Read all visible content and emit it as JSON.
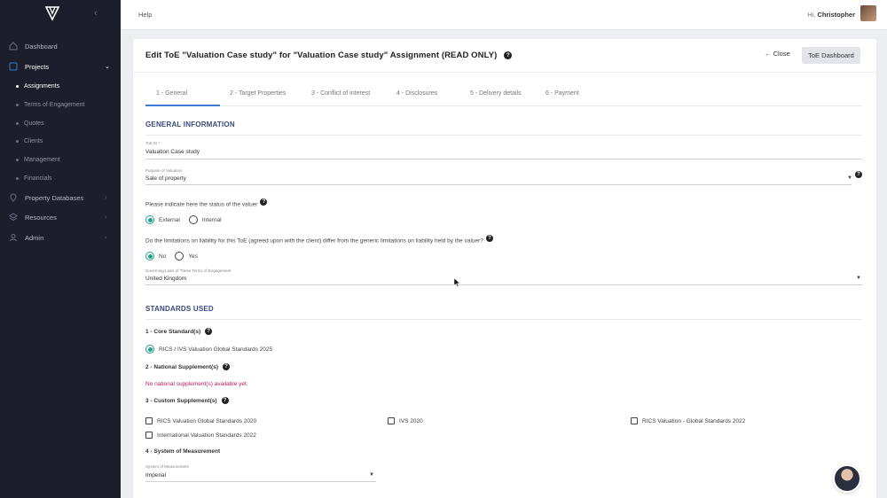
{
  "sidebar": {
    "items": [
      {
        "label": "Dashboard",
        "icon": "home-icon"
      },
      {
        "label": "Projects",
        "icon": "projects-icon"
      },
      {
        "label": "Property Databases",
        "icon": "location-icon"
      },
      {
        "label": "Resources",
        "icon": "layers-icon"
      },
      {
        "label": "Admin",
        "icon": "admin-icon"
      }
    ],
    "project_subitems": [
      {
        "label": "Assignments"
      },
      {
        "label": "Terms of Engagement"
      },
      {
        "label": "Quotes"
      },
      {
        "label": "Clients"
      },
      {
        "label": "Management"
      },
      {
        "label": "Financials"
      }
    ]
  },
  "topbar": {
    "help": "Help",
    "greeting": "Hi,",
    "user": "Christopher"
  },
  "page": {
    "title": "Edit ToE \"Valuation Case study\" for \"Valuation Case study\" Assignment (READ ONLY)",
    "help_icon": "?",
    "close_label": "Close",
    "close_arrow": "←",
    "dashboard_label": "ToE Dashboard"
  },
  "tabs": [
    {
      "label": "1 - General",
      "active": true
    },
    {
      "label": "2 - Target Properties"
    },
    {
      "label": "3 - Conflict of interest"
    },
    {
      "label": "4 - Disclosures"
    },
    {
      "label": "5 - Delivery details"
    },
    {
      "label": "6 - Payment"
    }
  ],
  "general": {
    "section_title": "GENERAL INFORMATION",
    "toe_id_label": "ToE ID *",
    "toe_id_value": "Valuation Case study",
    "purpose_label": "Purpose of Valuation",
    "purpose_value": "Sale of property",
    "valuer_status_question": "Please indicate here the status of the valuer",
    "valuer_options": [
      "External",
      "Internal"
    ],
    "valuer_selected": "External",
    "liability_question": "Do the limitations on liability for this ToE (agreed upon with the client) differ from the generic limitations on liability held by the valuer?",
    "liability_options": [
      "No",
      "Yes"
    ],
    "liability_selected": "No",
    "governing_label": "Governing Laws of These Terms of Engagement",
    "governing_value": "United Kingdom"
  },
  "standards": {
    "section_title": "STANDARDS USED",
    "core_heading": "1 - Core Standard(s)",
    "core_option": "RICS / IVS Valuation Global Standards 2025",
    "national_heading": "2 - National Supplement(s)",
    "national_warning": "No national supplement(s) available yet.",
    "custom_heading": "3 - Custom Supplement(s)",
    "custom_options": [
      "RICS Valuation Global Standards 2020",
      "IVS 2020",
      "RICS Valuation - Global Standards 2022",
      "International Valuation Standards 2022"
    ],
    "measurement_heading": "4 - System of Measurement",
    "measurement_label": "System of Measurement",
    "measurement_value": "Imperial"
  },
  "colors": {
    "sidebar_bg": "#1c1e2b",
    "accent_tab": "#3a7bd5",
    "radio_on": "#1aa689",
    "section_title": "#3a4a80",
    "warning": "#c2185b"
  }
}
